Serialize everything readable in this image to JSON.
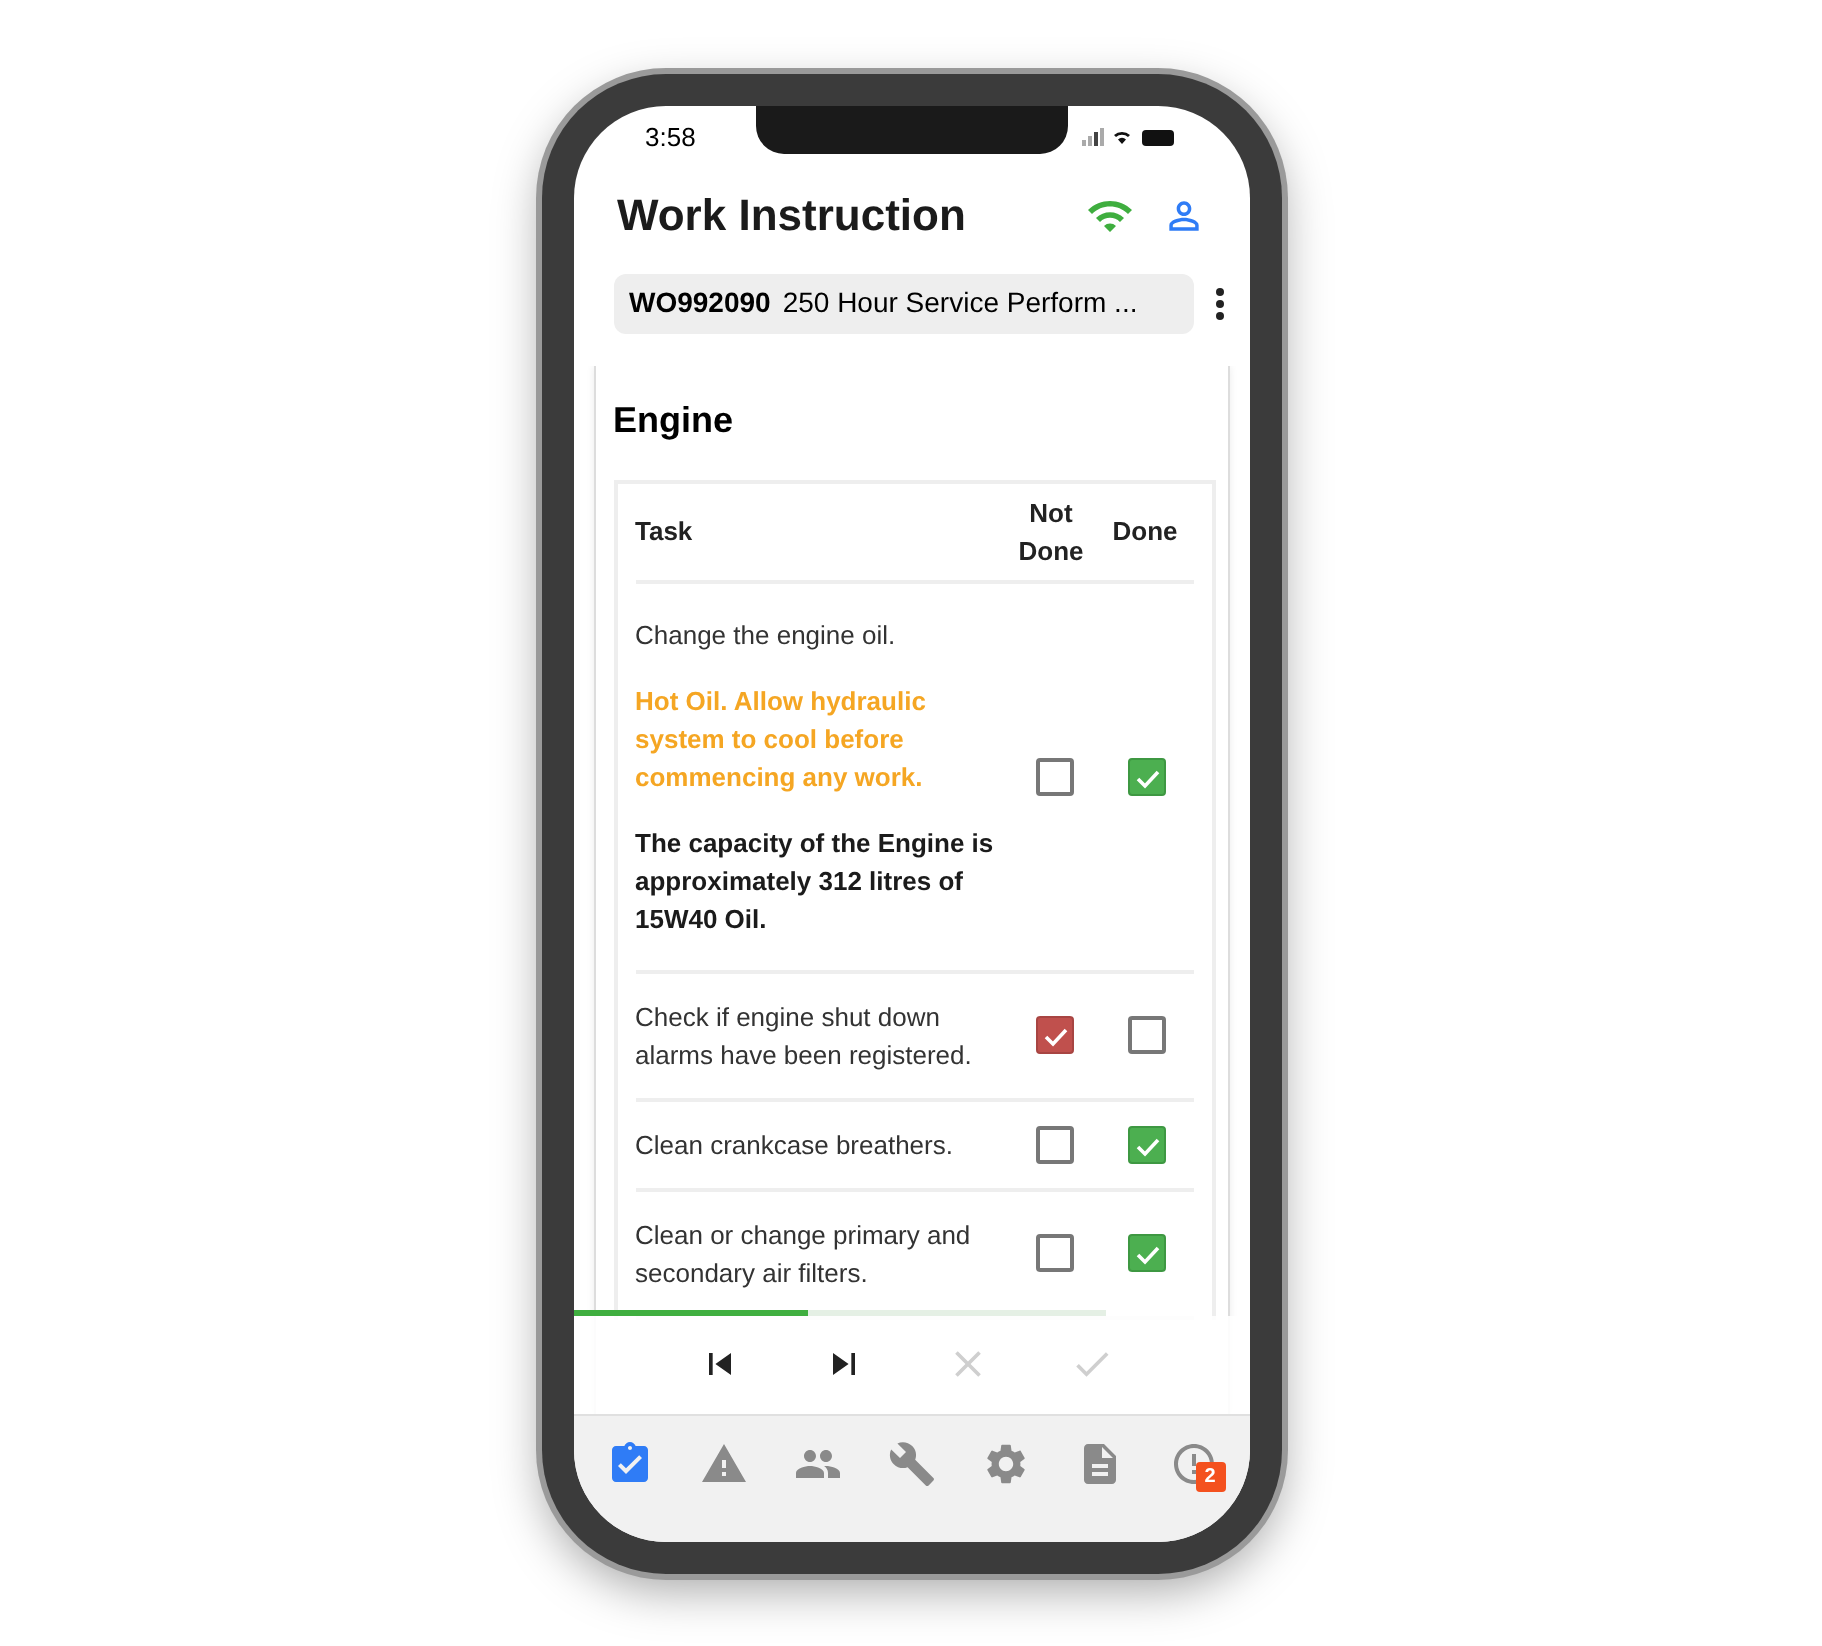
{
  "status_bar": {
    "time": "3:58"
  },
  "header": {
    "title": "Work Instruction"
  },
  "work_order": {
    "number": "WO992090",
    "description": "250 Hour Service Perform ..."
  },
  "section": {
    "title": "Engine",
    "columns": [
      "Task",
      "Not Done",
      "Done"
    ],
    "rows": [
      {
        "texts": [
          {
            "kind": "plain",
            "text": "Change the engine oil."
          },
          {
            "kind": "warning",
            "text": "Hot Oil. Allow hydraulic system to cool before commencing any work."
          },
          {
            "kind": "note",
            "text": "The capacity of the Engine is approximately 312 litres of 15W40 Oil."
          }
        ],
        "not_done": false,
        "done": true
      },
      {
        "texts": [
          {
            "kind": "plain",
            "text": "Check if engine shut down alarms have been registered."
          }
        ],
        "not_done": true,
        "done": false
      },
      {
        "texts": [
          {
            "kind": "plain",
            "text": "Clean crankcase breathers."
          }
        ],
        "not_done": false,
        "done": true
      },
      {
        "texts": [
          {
            "kind": "plain",
            "text": "Clean or change primary and secondary air filters."
          }
        ],
        "not_done": false,
        "done": true
      }
    ]
  },
  "progress": {
    "level": 0.44
  },
  "toolbar": [
    {
      "kind": "first",
      "disabled": false
    },
    {
      "kind": "last",
      "disabled": false
    },
    {
      "kind": "cancel",
      "disabled": true
    },
    {
      "kind": "confirm",
      "disabled": true
    }
  ],
  "nav": [
    {
      "kind": "checklist",
      "selected": true
    },
    {
      "kind": "hazard",
      "selected": false
    },
    {
      "kind": "people",
      "selected": false
    },
    {
      "kind": "tools",
      "selected": false
    },
    {
      "kind": "settings",
      "selected": false
    },
    {
      "kind": "document",
      "selected": false
    },
    {
      "kind": "alerts",
      "selected": false,
      "badge": "2"
    }
  ]
}
